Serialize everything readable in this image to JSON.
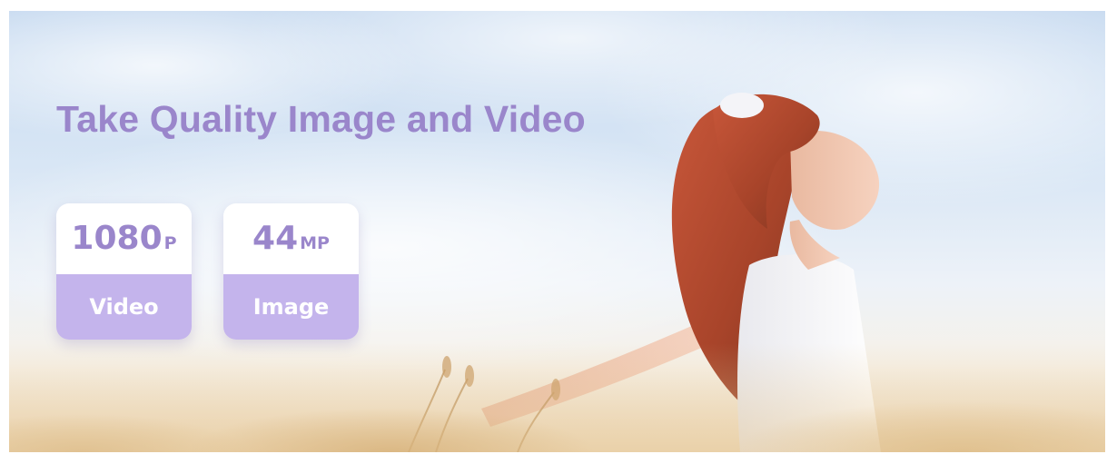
{
  "banner": {
    "headline": "Take Quality Image and Video",
    "features": [
      {
        "value": "1080",
        "unit": "P",
        "label": "Video"
      },
      {
        "value": "44",
        "unit": "MP",
        "label": "Image"
      }
    ]
  },
  "colors": {
    "accent": "#9a86cb",
    "card_bottom": "#c4b4ec",
    "card_top": "#ffffff"
  },
  "icons": {
    "photo": "girl-in-wheat-field-photo"
  }
}
